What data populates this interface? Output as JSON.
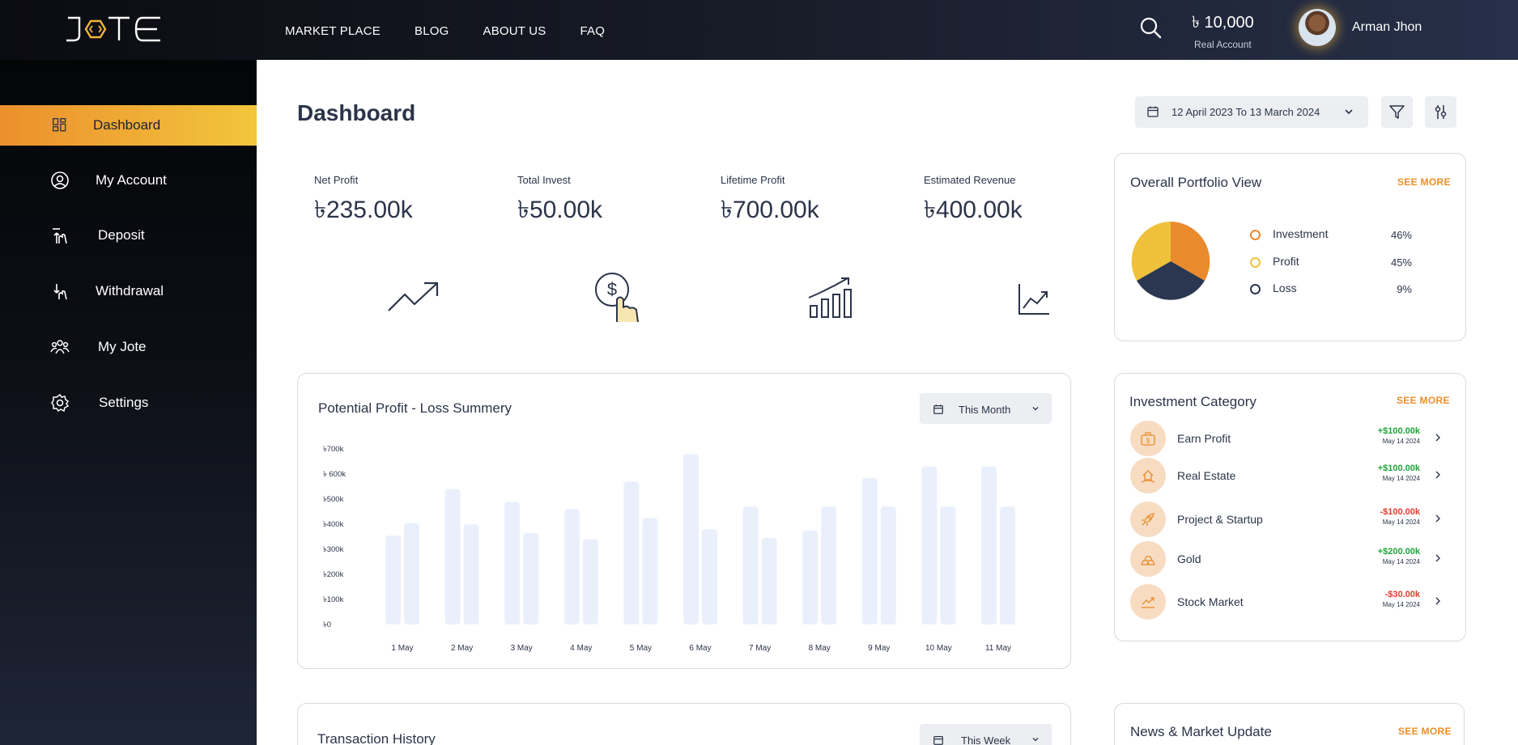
{
  "header": {
    "logo_text": "JOTE",
    "nav": [
      "MARKET PLACE",
      "BLOG",
      "ABOUT US",
      "FAQ"
    ],
    "balance_amount": "৳ 10,000",
    "balance_type": "Real Account",
    "user_name": "Arman Jhon"
  },
  "sidebar": {
    "items": [
      {
        "label": "Dashboard",
        "icon": "dashboard-grid-icon",
        "active": true
      },
      {
        "label": "My Account",
        "icon": "user-circle-icon"
      },
      {
        "label": "Deposit",
        "icon": "deposit-hand-icon"
      },
      {
        "label": "Withdrawal",
        "icon": "withdrawal-hand-icon"
      },
      {
        "label": "My Jote",
        "icon": "group-icon"
      },
      {
        "label": "Settings",
        "icon": "gear-icon"
      }
    ]
  },
  "main": {
    "title": "Dashboard",
    "date_range": "12 April 2023 To 13 March 2024"
  },
  "stats": [
    {
      "label": "Net Profit",
      "value": "৳235.00k",
      "color": "#f6d1ad",
      "icon": "trend-up-icon"
    },
    {
      "label": "Total Invest",
      "value": "৳50.00k",
      "color": "#f8e6b0",
      "icon": "dollar-touch-icon"
    },
    {
      "label": "Lifetime Profit",
      "value": "৳700.00k",
      "color": "#c4cde6",
      "icon": "bar-growth-icon"
    },
    {
      "label": "Estimated Revenue",
      "value": "৳400.00k",
      "color": "#a6a9b4",
      "icon": "line-chart-icon"
    }
  ],
  "portfolio": {
    "title": "Overall Portfolio View",
    "see_more": "SEE MORE",
    "legend": [
      {
        "name": "Investment",
        "percent": "46%",
        "color": "#e98a2c"
      },
      {
        "name": "Profit",
        "percent": "45%",
        "color": "#efc13a"
      },
      {
        "name": "Loss",
        "percent": "9%",
        "color": "#2b3650"
      }
    ]
  },
  "summary": {
    "title": "Potential Profit - Loss Summery",
    "period": "This Month"
  },
  "chart_data": {
    "type": "bar",
    "categories": [
      "1 May",
      "2 May",
      "3 May",
      "4 May",
      "5 May",
      "6 May",
      "7 May",
      "8 May",
      "9 May",
      "10 May",
      "11 May"
    ],
    "series": [
      {
        "values": [
          355,
          540,
          490,
          460,
          570,
          680,
          470,
          375,
          585,
          630,
          630
        ]
      },
      {
        "values": [
          405,
          400,
          365,
          340,
          425,
          380,
          345,
          470,
          470,
          470,
          470
        ]
      }
    ],
    "yticks": [
      "৳700k",
      "৳ 600k",
      "৳500k",
      "৳400k",
      "৳300k",
      "৳200k",
      "৳100k",
      "৳0"
    ],
    "ylim": [
      0,
      700
    ],
    "bar_color": "#eaf0fb"
  },
  "investment_category": {
    "title": "Investment Category",
    "see_more": "SEE MORE",
    "items": [
      {
        "name": "Earn Profit",
        "amount": "+$100.00k",
        "date": "May 14  2024",
        "positive": true
      },
      {
        "name": "Real Estate",
        "amount": "+$100.00k",
        "date": "May 14  2024",
        "positive": true
      },
      {
        "name": "Project & Startup",
        "amount": "-$100.00k",
        "date": "May 14  2024",
        "positive": false
      },
      {
        "name": "Gold",
        "amount": "+$200.00k",
        "date": "May 14  2024",
        "positive": true
      },
      {
        "name": "Stock Market",
        "amount": "-$30.00k",
        "date": "May 14  2024",
        "positive": false
      }
    ]
  },
  "transactions": {
    "title": "Transaction History",
    "period": "This Week"
  },
  "news": {
    "title": "News & Market Update",
    "see_more": "SEE MORE"
  },
  "colors": {
    "accent": "#ec8f2c",
    "positive": "#1fa33a",
    "negative": "#e23b2e"
  }
}
